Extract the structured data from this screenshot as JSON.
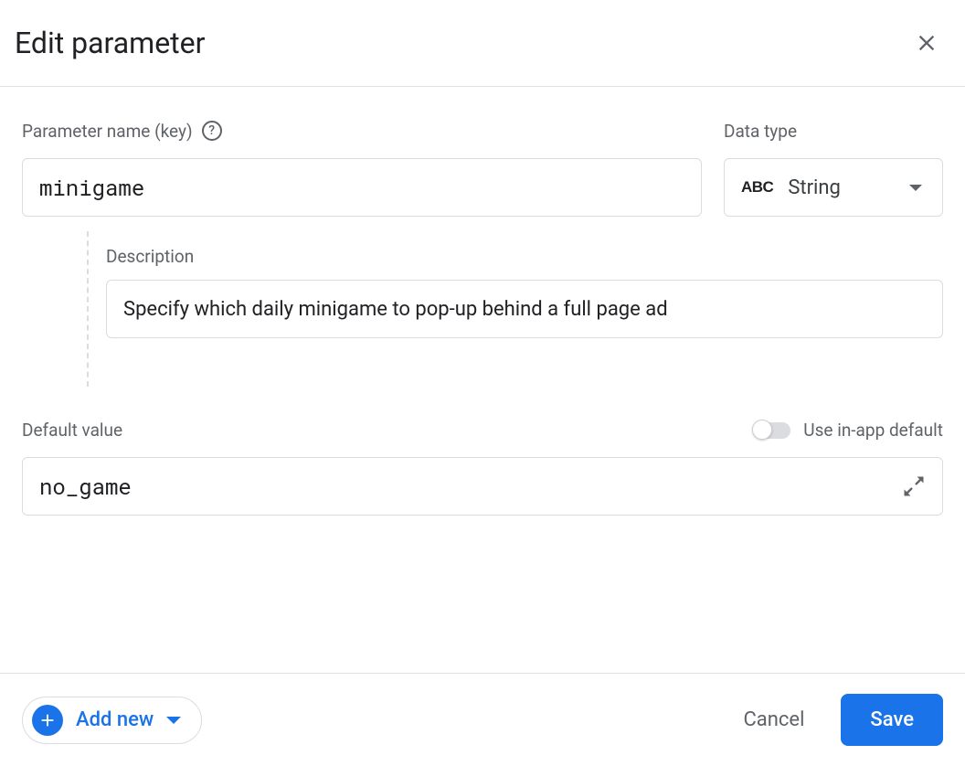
{
  "dialog": {
    "title": "Edit parameter"
  },
  "param_name": {
    "label": "Parameter name (key)",
    "value": "minigame"
  },
  "data_type": {
    "label": "Data type",
    "icon_text": "ABC",
    "selected": "String"
  },
  "description": {
    "label": "Description",
    "value": "Specify which daily minigame to pop-up behind a full page ad"
  },
  "default_value": {
    "label": "Default value",
    "toggle_label": "Use in-app default",
    "toggle_on": false,
    "value": "no_game"
  },
  "footer": {
    "add_new_label": "Add new",
    "cancel_label": "Cancel",
    "save_label": "Save"
  }
}
